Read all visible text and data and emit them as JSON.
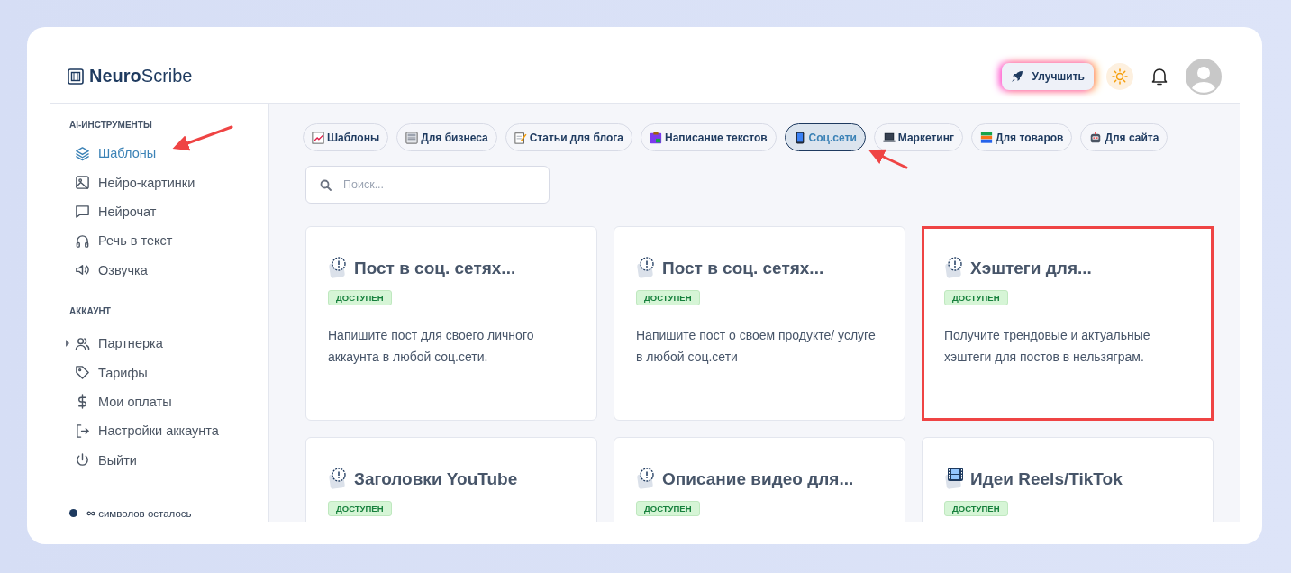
{
  "header": {
    "logo": {
      "bold": "Neuro",
      "light": "Scribe"
    },
    "upgrade_button": "Улучшить"
  },
  "sidebar": {
    "sections": [
      {
        "title": "AI-ИНСТРУМЕНТЫ",
        "items": [
          {
            "label": "Шаблоны",
            "selected": true
          },
          {
            "label": "Нейро-картинки",
            "selected": false
          },
          {
            "label": "Нейрочат",
            "selected": false
          },
          {
            "label": "Речь в текст",
            "selected": false
          },
          {
            "label": "Озвучка",
            "selected": false
          }
        ]
      },
      {
        "title": "АККАУНТ",
        "items": [
          {
            "label": "Партнерка",
            "selected": false,
            "expanded": false
          },
          {
            "label": "Тарифы",
            "selected": false
          },
          {
            "label": "Мои оплаты",
            "selected": false
          },
          {
            "label": "Настройки аккаунта",
            "selected": false
          },
          {
            "label": "Выйти",
            "selected": false
          }
        ]
      }
    ],
    "quota": "**∞** символов осталось"
  },
  "categories": [
    {
      "label": "Шаблоны",
      "selected": false
    },
    {
      "label": "Для бизнеса",
      "selected": false
    },
    {
      "label": "Статьи для блога",
      "selected": false
    },
    {
      "label": "Написание текстов",
      "selected": false
    },
    {
      "label": "Соц.сети",
      "selected": true
    },
    {
      "label": "Маркетинг",
      "selected": false
    },
    {
      "label": "Для товаров",
      "selected": false
    },
    {
      "label": "Для сайта",
      "selected": false
    }
  ],
  "search": {
    "placeholder": "Поиск..."
  },
  "cards": [
    {
      "kind": "alert",
      "title": "Пост в соц. сетях...",
      "badge": "ДОСТУПЕН",
      "description": "Напишите пост для своего личного аккаунта в любой соц.сети.",
      "highlighted": false
    },
    {
      "kind": "alert",
      "title": "Пост в соц. сетях...",
      "badge": "ДОСТУПЕН",
      "description": "Напишите пост о своем продукте/ услуге в любой соц.сети",
      "highlighted": false
    },
    {
      "kind": "alert",
      "title": "Хэштеги для...",
      "badge": "ДОСТУПЕН",
      "description": "Получите трендовые и актуальные хэштеги для постов в нельзяграм.",
      "highlighted": true
    },
    {
      "kind": "alert",
      "title": "Заголовки YouTube",
      "badge": "ДОСТУПЕН",
      "highlighted": false
    },
    {
      "kind": "alert",
      "title": "Описание видео для...",
      "badge": "ДОСТУПЕН",
      "highlighted": false
    },
    {
      "kind": "film",
      "title": "Идеи Reels/TikTok",
      "badge": "ДОСТУПЕН",
      "highlighted": false
    }
  ]
}
